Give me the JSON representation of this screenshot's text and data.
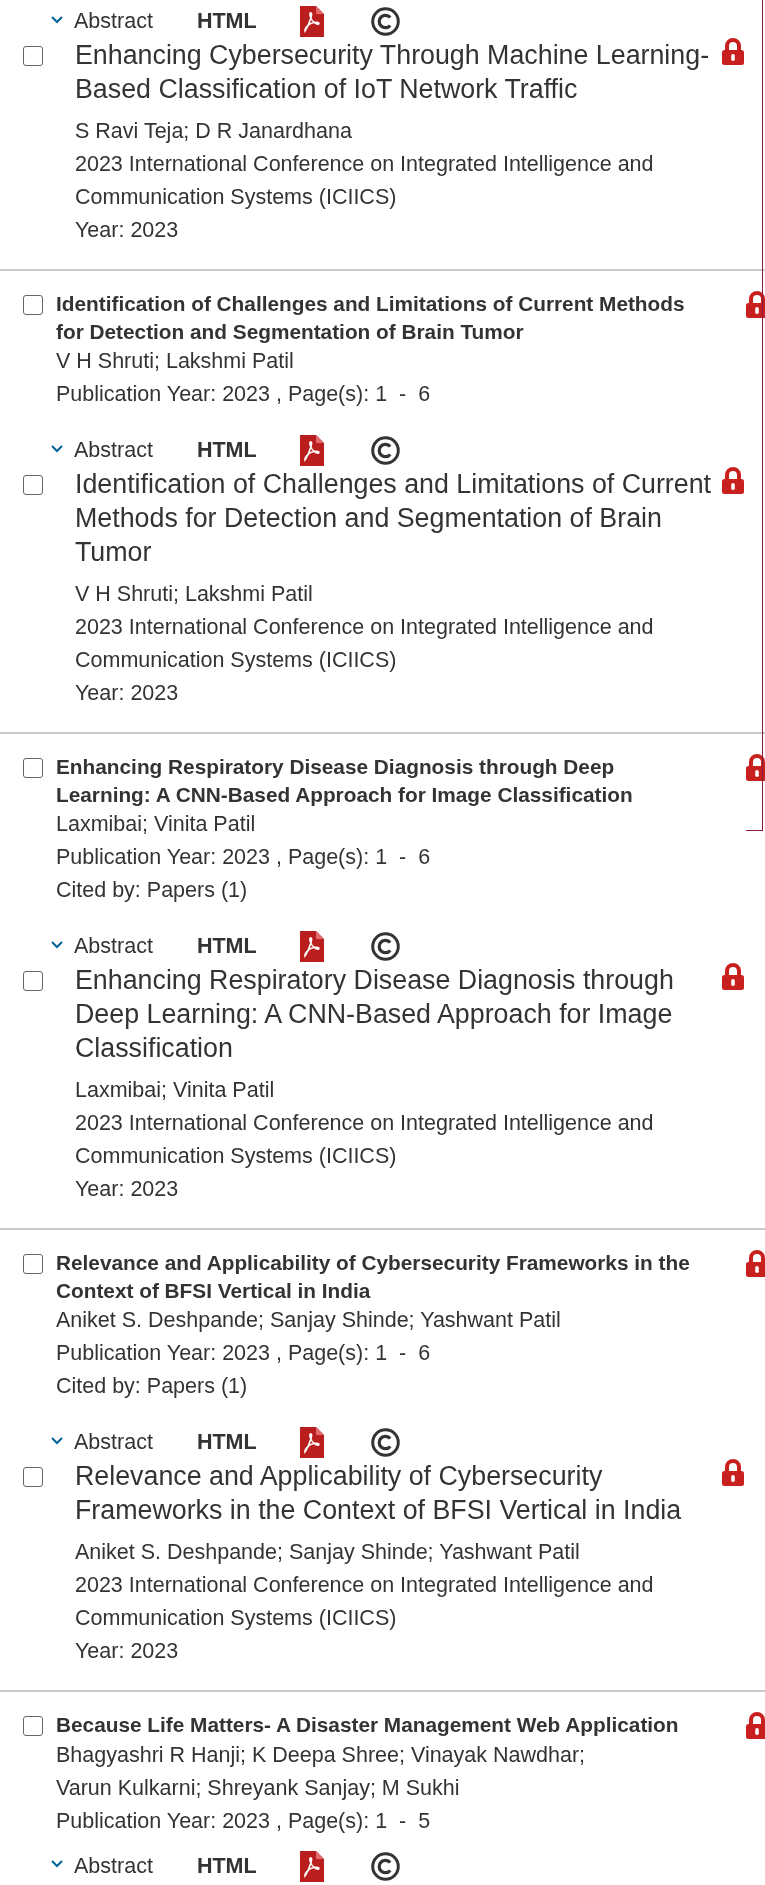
{
  "results": [
    {
      "abstract": {
        "label": "Abstract",
        "expanded": true
      },
      "html": "HTML",
      "detail": {
        "checked": false,
        "title": "Enhancing Cybersecurity Through Machine Learning-Based Classification of IoT Network Traffic",
        "authors": "S Ravi Teja; D R Janardhana",
        "venue": "2023 International Conference on Integrated Intelligence and Communication Systems (ICIICS)",
        "year": "Year: 2023"
      }
    },
    {
      "checked": false,
      "title": "Identification of Challenges and Limitations of Current Methods for Detection and Segmentation of Brain Tumor",
      "authors": "V H Shruti; Lakshmi Patil",
      "publication": "Publication Year: 2023 , Page(s): 1  -  6",
      "abstract": {
        "label": "Abstract",
        "expanded": true
      },
      "html": "HTML",
      "detail": {
        "checked": false,
        "title": "Identification of Challenges and Limitations of Current Methods for Detection and Segmentation of Brain Tumor",
        "authors": "V H Shruti; Lakshmi Patil",
        "venue": "2023 International Conference on Integrated Intelligence and Communication Systems (ICIICS)",
        "year": "Year: 2023"
      }
    },
    {
      "checked": false,
      "title": "Enhancing Respiratory Disease Diagnosis through Deep Learning: A CNN-Based Approach for Image Classification",
      "authors": "Laxmibai; Vinita Patil",
      "publication": "Publication Year: 2023 , Page(s): 1  -  6",
      "cited_by": "Cited by: Papers (1)",
      "abstract": {
        "label": "Abstract",
        "expanded": true
      },
      "html": "HTML",
      "detail": {
        "checked": false,
        "title": "Enhancing Respiratory Disease Diagnosis through Deep Learning: A CNN-Based Approach for Image Classification",
        "authors": "Laxmibai; Vinita Patil",
        "venue": "2023 International Conference on Integrated Intelligence and Communication Systems (ICIICS)",
        "year": "Year: 2023"
      }
    },
    {
      "checked": false,
      "title": "Relevance and Applicability of Cybersecurity Frameworks in the Context of BFSI Vertical in India",
      "authors": "Aniket S. Deshpande; Sanjay Shinde; Yashwant Patil",
      "publication": "Publication Year: 2023 , Page(s): 1  -  6",
      "cited_by": "Cited by: Papers (1)",
      "abstract": {
        "label": "Abstract",
        "expanded": true
      },
      "html": "HTML",
      "detail": {
        "checked": false,
        "title": "Relevance and Applicability of Cybersecurity Frameworks in the Context of BFSI Vertical in India",
        "authors": "Aniket S. Deshpande; Sanjay Shinde; Yashwant Patil",
        "venue": "2023 International Conference on Integrated Intelligence and Communication Systems (ICIICS)",
        "year": "Year: 2023"
      }
    },
    {
      "checked": false,
      "title": "Because Life Matters- A Disaster Management Web Application",
      "authors": "Bhagyashri R Hanji; K Deepa Shree; Vinayak Nawdhar; Varun Kulkarni; Shreyank Sanjay; M Sukhi",
      "publication": "Publication Year: 2023 , Page(s): 1  -  5",
      "abstract": {
        "label": "Abstract",
        "expanded": true
      },
      "html": "HTML"
    }
  ]
}
